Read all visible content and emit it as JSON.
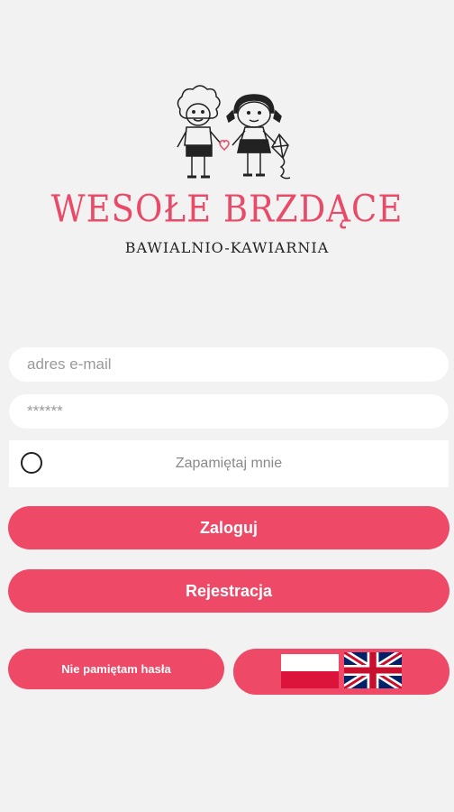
{
  "brand": {
    "title": "WESOŁE BRZDĄCE",
    "subtitle": "BAWIALNIO-KAWIARNIA"
  },
  "login_form": {
    "email_placeholder": "adres e-mail",
    "password_placeholder": "******",
    "remember_label": "Zapamiętaj mnie",
    "login_label": "Zaloguj",
    "register_label": "Rejestracja"
  },
  "footer": {
    "forgot_label": "Nie pamiętam hasła",
    "languages": [
      "polish-flag-icon",
      "uk-flag-icon"
    ]
  },
  "colors": {
    "accent": "#ee4966",
    "background": "#f2f2f2"
  }
}
